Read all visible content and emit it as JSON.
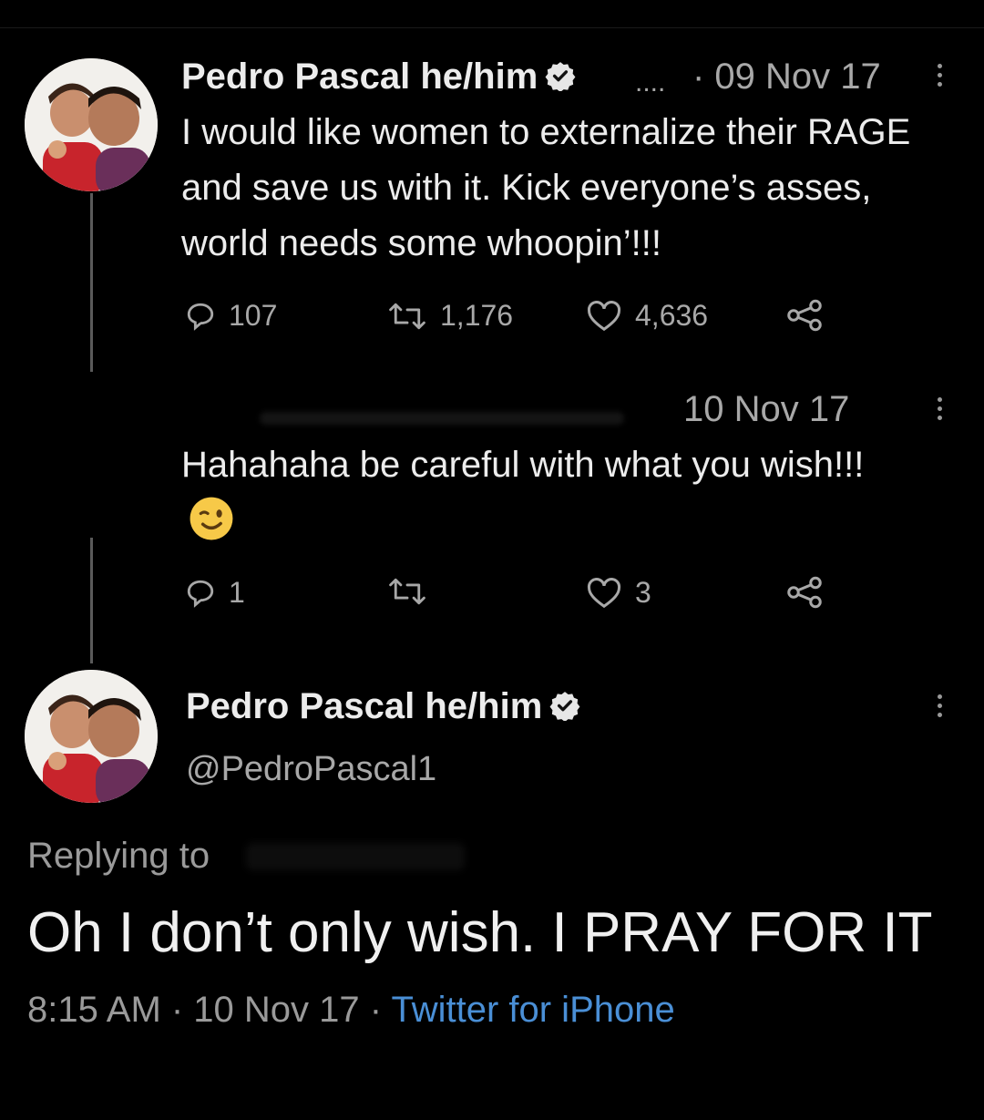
{
  "tweet1": {
    "name": "Pedro Pascal he/him",
    "ellipsis": "....",
    "date": "· 09 Nov 17",
    "text": "I would like women to externalize their RAGE and save us with it. Kick everyone’s asses, world needs some whoopin’!!!",
    "replies": "107",
    "retweets": "1,176",
    "likes": "4,636"
  },
  "tweet2": {
    "date": "10 Nov 17",
    "text": "Hahahaha be careful with what you wish!!!",
    "emoji": "winking-face",
    "replies": "1",
    "retweets": "",
    "likes": "3"
  },
  "main_tweet": {
    "name": "Pedro Pascal he/him",
    "handle": "@PedroPascal1",
    "replying_to": "Replying to",
    "text": "Oh I don’t only wish. I PRAY FOR IT",
    "time": "8:15 AM · 10 Nov 17 · ",
    "source": "Twitter for iPhone"
  },
  "colors": {
    "background": "#000000",
    "verified_badge": "#e6e6e6",
    "link": "#4a8fd6"
  },
  "icons": [
    "verified-badge-icon",
    "reply-icon",
    "retweet-icon",
    "like-icon",
    "share-icon",
    "more-icon",
    "winking-face-emoji"
  ]
}
